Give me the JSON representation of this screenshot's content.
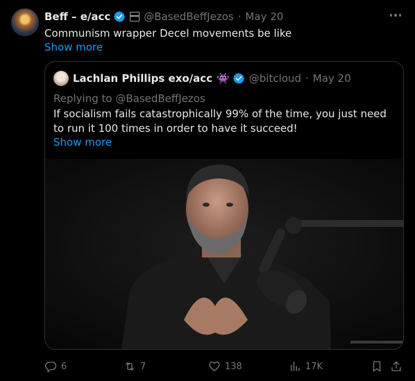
{
  "post": {
    "author_name": "Beff – e/acc",
    "author_handle": "@BasedBeffJezos",
    "separator": "·",
    "date": "May 20",
    "text": "Communism wrapper Decel movements be like",
    "show_more": "Show more",
    "verified_color": "#1d9bf0"
  },
  "quote": {
    "author_name": "Lachlan Phillips exo/acc",
    "author_badge_icon": "space-invader-icon",
    "author_handle": "@bitcloud",
    "separator": "·",
    "date": "May 20",
    "replying_to": "Replying to @BasedBeffJezos",
    "text": "If socialism fails catastrophically 99% of the time, you just need to run it 100 times in order to have it succeed!",
    "show_more": "Show more"
  },
  "actions": {
    "replies": "6",
    "reposts": "7",
    "likes": "138",
    "views": "17K"
  }
}
